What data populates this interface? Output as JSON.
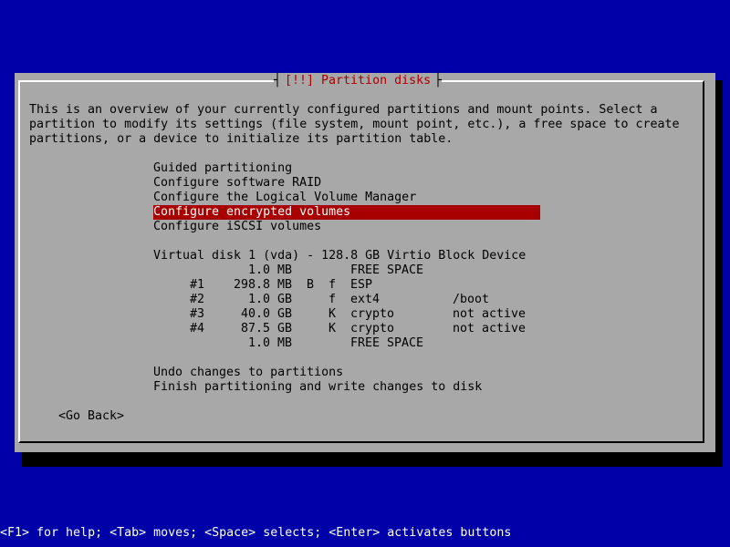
{
  "dialog": {
    "title": "[!!] Partition disks",
    "description": [
      "This is an overview of your currently configured partitions and mount points. Select a",
      "partition to modify its settings (file system, mount point, etc.), a free space to create",
      "partitions, or a device to initialize its partition table."
    ],
    "menu": [
      "Guided partitioning",
      "Configure software RAID",
      "Configure the Logical Volume Manager",
      "Configure encrypted volumes",
      "Configure iSCSI volumes"
    ],
    "selected_index": 3,
    "disk": {
      "header": "Virtual disk 1 (vda) - 128.8 GB Virtio Block Device",
      "rows": [
        {
          "num": "",
          "size": "1.0 MB",
          "flag1": "",
          "flag2": "",
          "fs": "FREE SPACE",
          "mount": ""
        },
        {
          "num": "#1",
          "size": "298.8 MB",
          "flag1": "B",
          "flag2": "f",
          "fs": "ESP",
          "mount": ""
        },
        {
          "num": "#2",
          "size": "1.0 GB",
          "flag1": "",
          "flag2": "f",
          "fs": "ext4",
          "mount": "/boot"
        },
        {
          "num": "#3",
          "size": "40.0 GB",
          "flag1": "",
          "flag2": "K",
          "fs": "crypto",
          "mount": "not active"
        },
        {
          "num": "#4",
          "size": "87.5 GB",
          "flag1": "",
          "flag2": "K",
          "fs": "crypto",
          "mount": "not active"
        },
        {
          "num": "",
          "size": "1.0 MB",
          "flag1": "",
          "flag2": "",
          "fs": "FREE SPACE",
          "mount": ""
        }
      ]
    },
    "actions": [
      "Undo changes to partitions",
      "Finish partitioning and write changes to disk"
    ],
    "go_back": "<Go Back>"
  },
  "footer": "<F1> for help; <Tab> moves; <Space> selects; <Enter> activates buttons",
  "colors": {
    "background": "#0000a8",
    "dialog": "#a8a8a8",
    "highlight": "#a80000",
    "title_text": "#a80000"
  }
}
